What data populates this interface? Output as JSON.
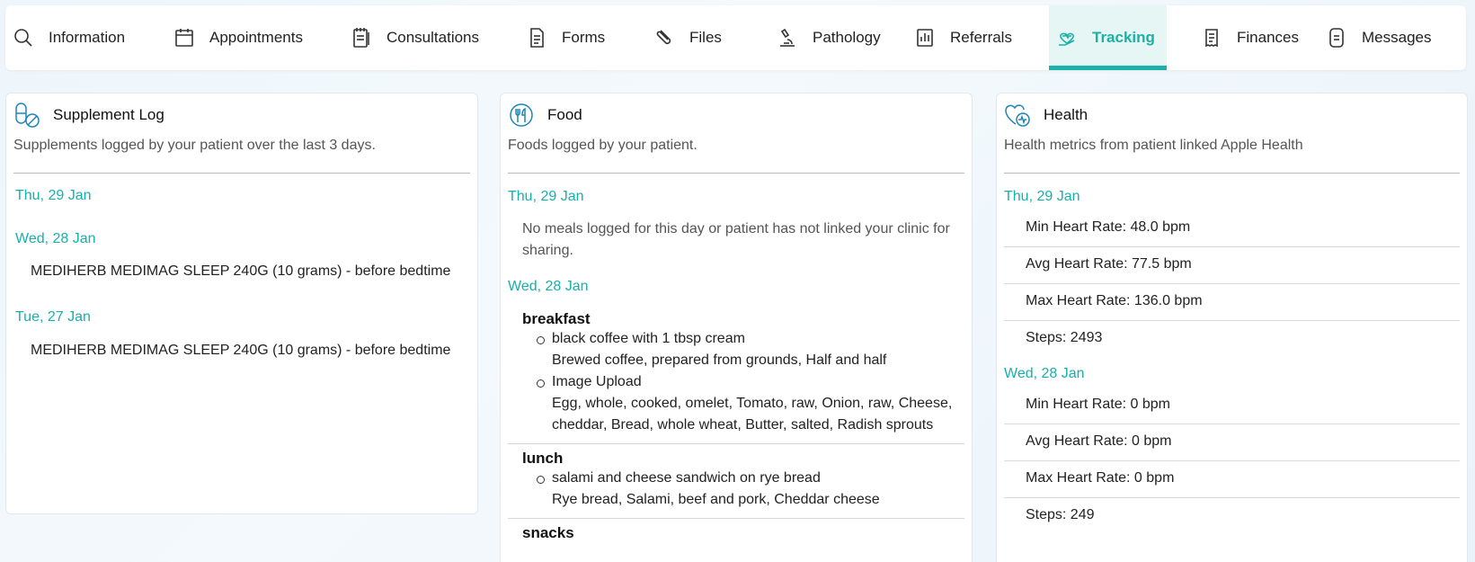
{
  "tabs": [
    {
      "label": "Information",
      "icon": "search-icon",
      "active": false
    },
    {
      "label": "Appointments",
      "icon": "calendar-icon",
      "active": false
    },
    {
      "label": "Consultations",
      "icon": "notepad-icon",
      "active": false
    },
    {
      "label": "Forms",
      "icon": "form-icon",
      "active": false
    },
    {
      "label": "Files",
      "icon": "paperclip-icon",
      "active": false
    },
    {
      "label": "Pathology",
      "icon": "microscope-icon",
      "active": false
    },
    {
      "label": "Referrals",
      "icon": "report-icon",
      "active": false
    },
    {
      "label": "Tracking",
      "icon": "heart-hand-icon",
      "active": true
    },
    {
      "label": "Finances",
      "icon": "receipt-icon",
      "active": false
    },
    {
      "label": "Messages",
      "icon": "message-doc-icon",
      "active": false
    }
  ],
  "accent_color": "#1ab1a6",
  "supplements": {
    "title": "Supplement Log",
    "description": "Supplements logged by your patient over the last 3 days.",
    "days": [
      {
        "date": "Thu, 29 Jan",
        "entries": []
      },
      {
        "date": "Wed, 28 Jan",
        "entries": [
          "MEDIHERB MEDIMAG SLEEP 240G (10 grams) - before bedtime"
        ]
      },
      {
        "date": "Tue, 27 Jan",
        "entries": [
          "MEDIHERB MEDIMAG SLEEP 240G (10 grams) - before bedtime"
        ]
      }
    ]
  },
  "food": {
    "title": "Food",
    "description": "Foods logged by your patient.",
    "day1": {
      "date": "Thu, 29 Jan",
      "empty_message": "No meals logged for this day or patient has not linked your clinic for sharing."
    },
    "day2": {
      "date": "Wed, 28 Jan",
      "breakfast": {
        "title": "breakfast",
        "items": [
          {
            "name": "black coffee with 1 tbsp cream",
            "detail": "Brewed coffee, prepared from grounds, Half and half"
          },
          {
            "name": "Image Upload",
            "detail": "Egg, whole, cooked, omelet, Tomato, raw, Onion, raw, Cheese, cheddar, Bread, whole wheat, Butter, salted, Radish sprouts"
          }
        ]
      },
      "lunch": {
        "title": "lunch",
        "items": [
          {
            "name": "salami and cheese sandwich on rye bread",
            "detail": "Rye bread, Salami, beef and pork, Cheddar cheese"
          }
        ]
      },
      "snacks": {
        "title": "snacks"
      }
    }
  },
  "health": {
    "title": "Health",
    "description": "Health metrics from patient linked Apple Health",
    "day1": {
      "date": "Thu, 29 Jan",
      "metrics": [
        "Min Heart Rate: 48.0 bpm",
        "Avg Heart Rate: 77.5 bpm",
        "Max Heart Rate: 136.0 bpm",
        "Steps: 2493"
      ]
    },
    "day2": {
      "date": "Wed, 28 Jan",
      "metrics": [
        "Min Heart Rate: 0 bpm",
        "Avg Heart Rate: 0 bpm",
        "Max Heart Rate: 0 bpm",
        "Steps: 249"
      ]
    }
  }
}
